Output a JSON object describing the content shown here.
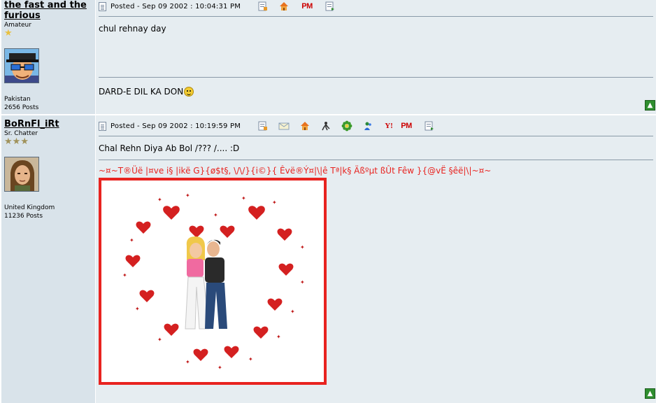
{
  "posts": [
    {
      "username": "the fast and the furious",
      "rank": "Amateur",
      "location": "Pakistan",
      "post_count": "2656 Posts",
      "posted_label": "Posted - Sep 09 2002 :  10:04:31 PM",
      "message": "chul rehnay day",
      "signature": "DARD-E DIL KA DON",
      "header_icons": [
        "edit-profile-icon",
        "homepage-icon",
        "pm-icon",
        "quote-icon"
      ]
    },
    {
      "username": "BoRnFl_iRt",
      "rank": "Sr. Chatter",
      "location": "United Kingdom",
      "post_count": "11236 Posts",
      "posted_label": "Posted - Sep 09 2002 :  10:19:59 PM",
      "message": "Chal Rehn Diya Ab Bol /??? /.... :D",
      "signature": "~¤~T®Üë |¤ve i§ |ikë G}{ø$t§, \\/\\/}{i©}{ Êvë®Ý¤|\\|ê Tª|k§ Äßºµt ßÛt Fêw }{@vË §êë|\\|~¤~",
      "header_icons": [
        "edit-profile-icon",
        "email-icon",
        "homepage-icon",
        "aim-icon",
        "icq-icon",
        "msn-icon",
        "yahoo-icon",
        "pm-icon",
        "quote-icon"
      ]
    }
  ],
  "icons": {
    "pm_text": "PM",
    "yahoo_text": "Y!"
  },
  "colors": {
    "sidebar_bg": "#d9e3ea",
    "main_bg": "#e6edf1",
    "signature_red": "#e8231f",
    "to_top_green": "#2f8e2f"
  }
}
